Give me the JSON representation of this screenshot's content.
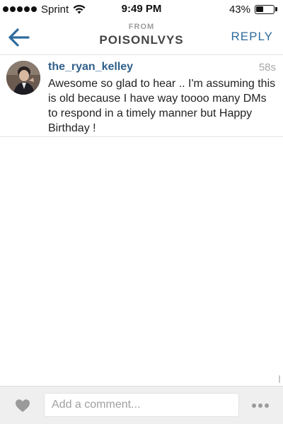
{
  "status_bar": {
    "carrier": "Sprint",
    "time": "9:49 PM",
    "battery_percent": "43%",
    "battery_level": 0.43,
    "signal_bars": 5,
    "icons": [
      "signal-dots-icon",
      "wifi-icon",
      "battery-icon"
    ]
  },
  "nav": {
    "from_label": "FROM",
    "title": "POISONLVYS",
    "reply_label": "REPLY",
    "back_icon": "back-arrow-icon",
    "accent_color": "#2f6b9c"
  },
  "message": {
    "username": "the_ryan_kelley",
    "time_ago": "58s",
    "text": "Awesome so glad to hear .. I'm assuming this is old because I have way toooo many DMs to respond in a timely manner but Happy Birthday !"
  },
  "composer": {
    "placeholder": "Add a comment...",
    "value": "",
    "like_icon": "heart-icon",
    "more_icon": "more-dots-icon"
  }
}
